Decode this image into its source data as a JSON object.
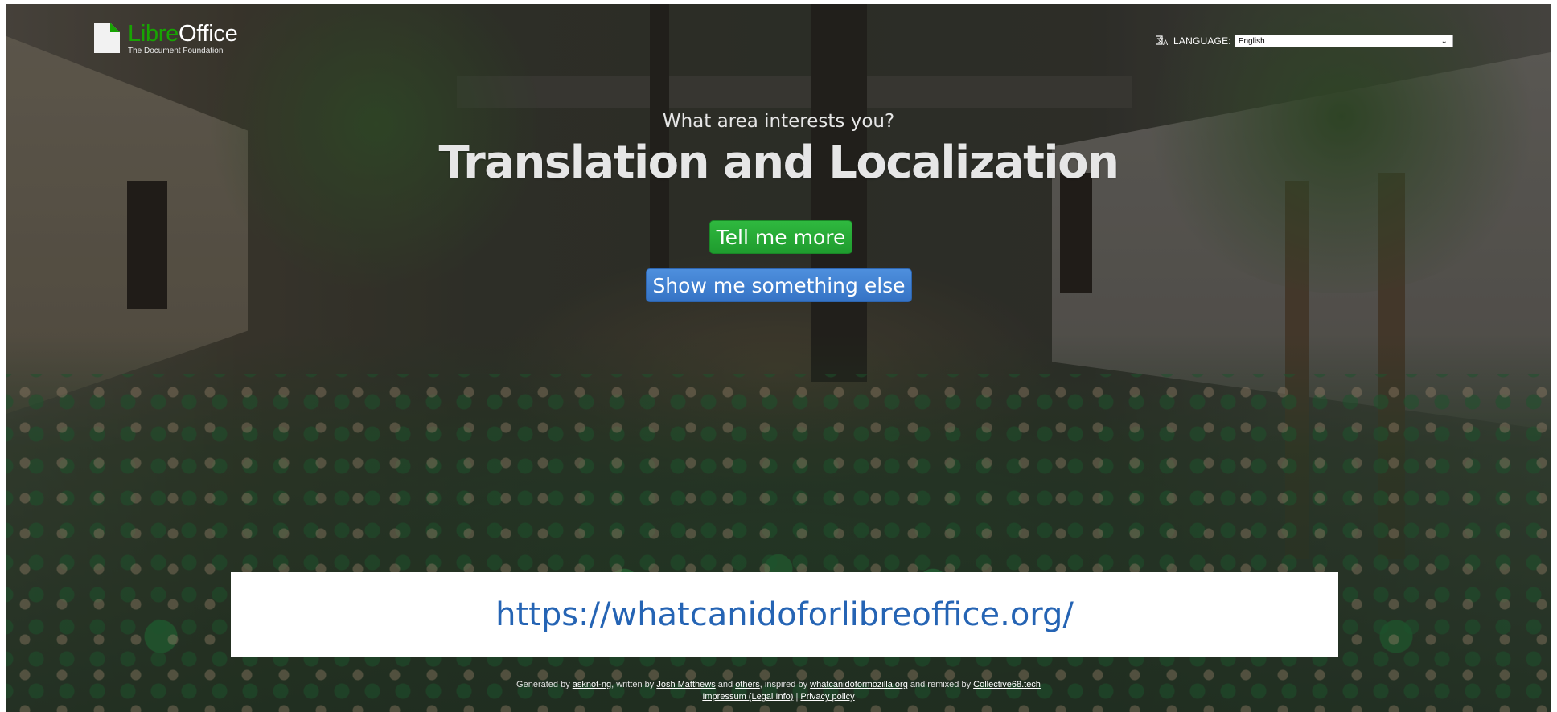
{
  "header": {
    "logo_libre": "Libre",
    "logo_office": "Office",
    "logo_subtitle": "The Document Foundation",
    "language_label": "LANGUAGE:",
    "language_selected": "English"
  },
  "main": {
    "question": "What area interests you?",
    "headline": "Translation and Localization",
    "primary_button": "Tell me more",
    "secondary_button": "Show me something else"
  },
  "banner": {
    "url": "https://whatcanidoforlibreoffice.org/"
  },
  "footer": {
    "generated_by": "Generated by",
    "asknot_link": "asknot-ng",
    "written_by": ", written by",
    "author_link": "Josh Matthews",
    "and": "and",
    "others_link": "others",
    "inspired_by": ", inspired by",
    "mozilla_link": "whatcanidoformozilla.org",
    "remixed_by": "and remixed by",
    "collective_link": "Collective68.tech",
    "impressum_link": "Impressum (Legal Info)",
    "separator": "|",
    "privacy_link": "Privacy policy"
  },
  "icons": {
    "language": "translate-icon",
    "select_chevron": "chevron-down-icon",
    "logo": "libreoffice-logo-icon"
  },
  "colors": {
    "libre_green": "#18a303",
    "primary_button": "#1f9c2e",
    "secondary_button": "#3573c5",
    "url_text": "#2564b4"
  }
}
